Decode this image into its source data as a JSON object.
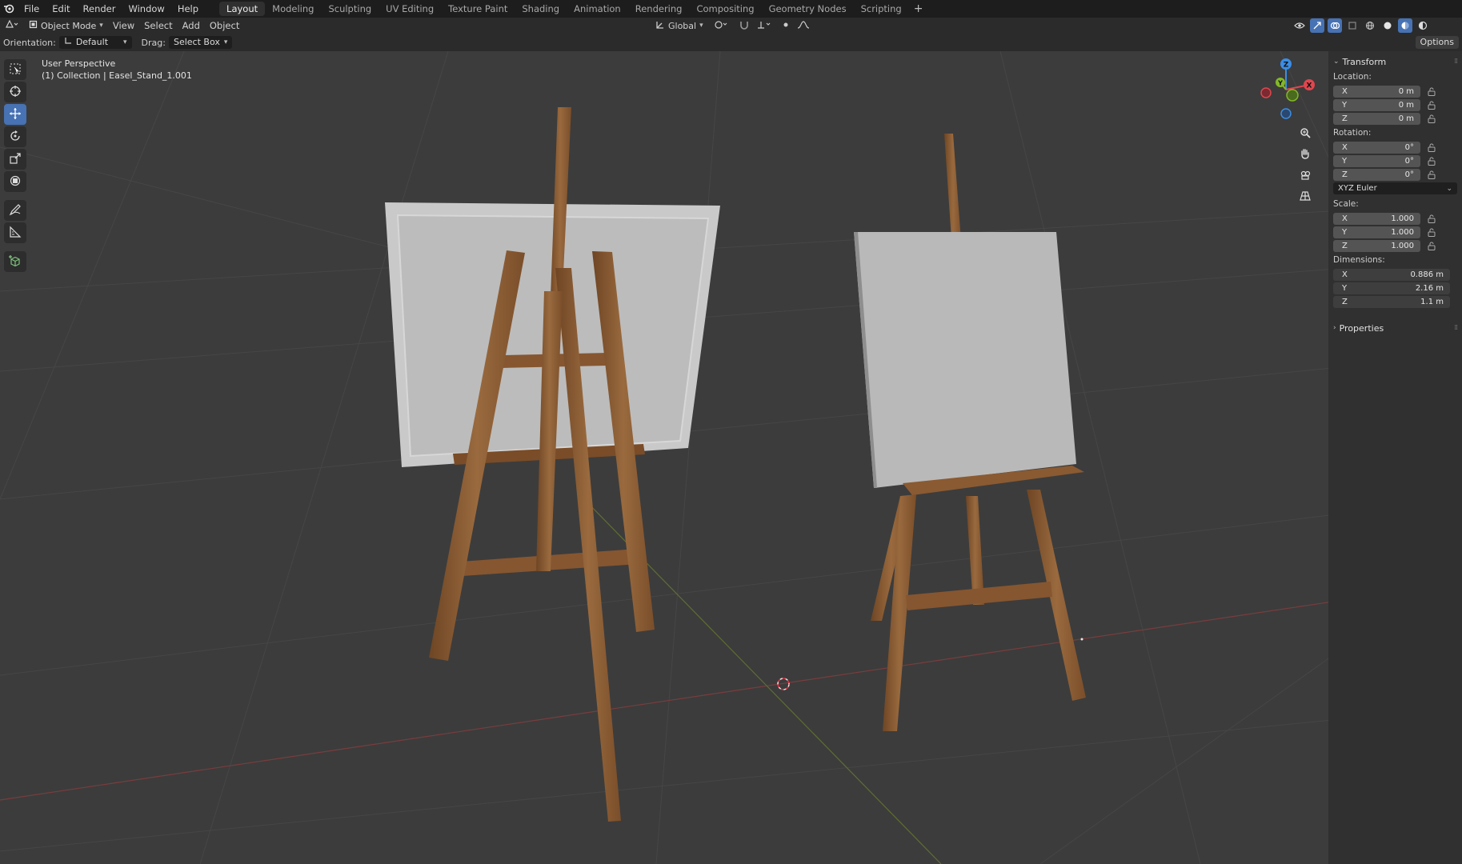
{
  "menu": {
    "items": [
      "File",
      "Edit",
      "Render",
      "Window",
      "Help"
    ]
  },
  "workspaces": {
    "tabs": [
      "Layout",
      "Modeling",
      "Sculpting",
      "UV Editing",
      "Texture Paint",
      "Shading",
      "Animation",
      "Rendering",
      "Compositing",
      "Geometry Nodes",
      "Scripting"
    ],
    "active": "Layout",
    "add_label": "+"
  },
  "header": {
    "mode": "Object Mode",
    "menus": [
      "View",
      "Select",
      "Add",
      "Object"
    ],
    "transform_orientation": "Global"
  },
  "tool_settings": {
    "orientation_label": "Orientation:",
    "orientation_value": "Default",
    "drag_label": "Drag:",
    "drag_value": "Select Box",
    "options_label": "Options"
  },
  "viewport": {
    "perspective": "User Perspective",
    "collection_info": "(1) Collection | Easel_Stand_1.001"
  },
  "gizmo": {
    "x_label": "X",
    "y_label": "Y",
    "z_label": "Z",
    "colors": {
      "x": "#e0464e",
      "y": "#82b828",
      "z": "#3a8ee6"
    }
  },
  "npanel": {
    "transform_title": "Transform",
    "location_label": "Location:",
    "location": [
      {
        "axis": "X",
        "value": "0 m"
      },
      {
        "axis": "Y",
        "value": "0 m"
      },
      {
        "axis": "Z",
        "value": "0 m"
      }
    ],
    "rotation_label": "Rotation:",
    "rotation": [
      {
        "axis": "X",
        "value": "0°"
      },
      {
        "axis": "Y",
        "value": "0°"
      },
      {
        "axis": "Z",
        "value": "0°"
      }
    ],
    "rotation_mode": "XYZ Euler",
    "scale_label": "Scale:",
    "scale": [
      {
        "axis": "X",
        "value": "1.000"
      },
      {
        "axis": "Y",
        "value": "1.000"
      },
      {
        "axis": "Z",
        "value": "1.000"
      }
    ],
    "dimensions_label": "Dimensions:",
    "dimensions": [
      {
        "axis": "X",
        "value": "0.886 m"
      },
      {
        "axis": "Y",
        "value": "2.16 m"
      },
      {
        "axis": "Z",
        "value": "1.1 m"
      }
    ],
    "properties_title": "Properties"
  },
  "colors": {
    "accent": "#4772b3",
    "wood": "#8a5a32",
    "canvas": "#b9b9b9"
  }
}
